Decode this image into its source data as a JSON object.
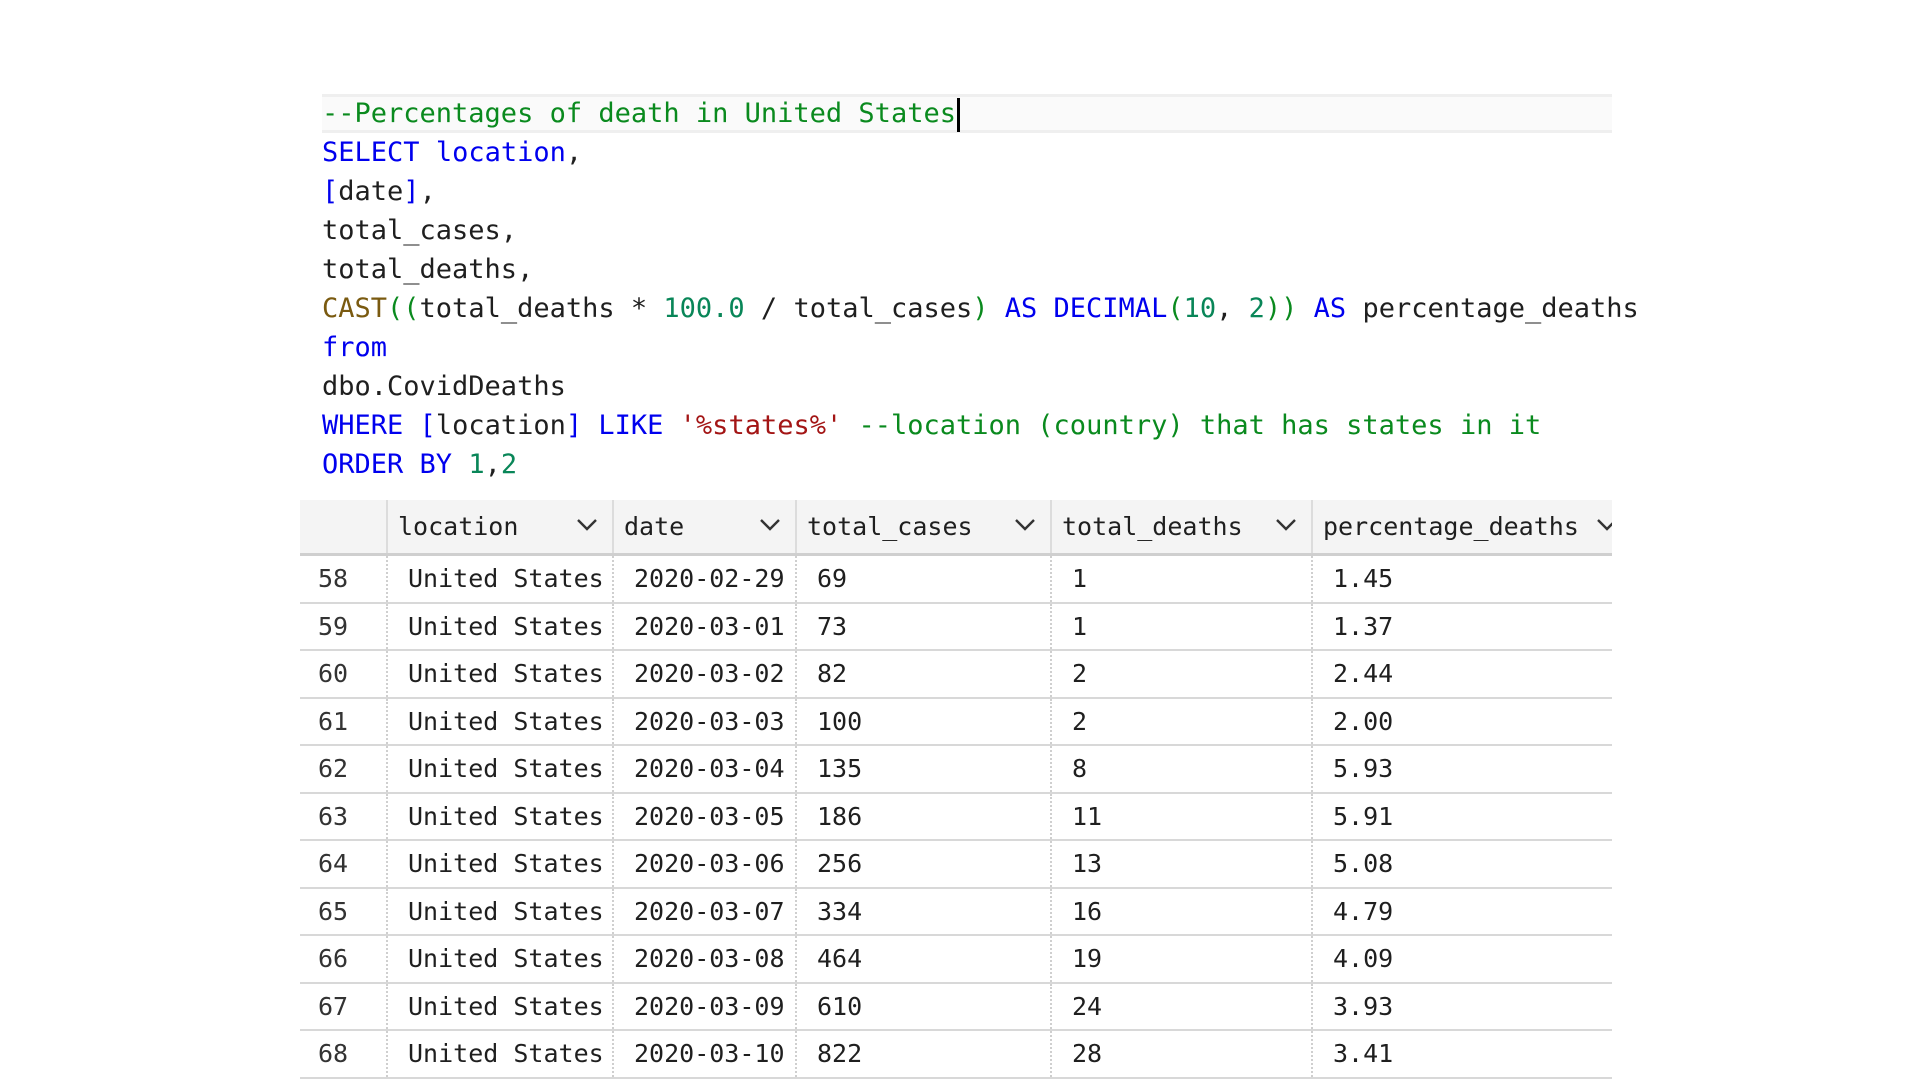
{
  "editor": {
    "lines": [
      [
        {
          "t": "--Percentages of death in United States",
          "c": "comment"
        }
      ],
      [
        {
          "t": "SELECT",
          "c": "kw"
        },
        {
          "t": " ",
          "c": "plain"
        },
        {
          "t": "location",
          "c": "kw"
        },
        {
          "t": ",",
          "c": "plain"
        }
      ],
      [
        {
          "t": "[",
          "c": "kw"
        },
        {
          "t": "date",
          "c": "plain"
        },
        {
          "t": "]",
          "c": "kw"
        },
        {
          "t": ",",
          "c": "plain"
        }
      ],
      [
        {
          "t": "total_cases,",
          "c": "plain"
        }
      ],
      [
        {
          "t": "total_deaths,",
          "c": "plain"
        }
      ],
      [
        {
          "t": "CAST",
          "c": "fn"
        },
        {
          "t": "((",
          "c": "br"
        },
        {
          "t": "total_deaths * ",
          "c": "plain"
        },
        {
          "t": "100.0",
          "c": "num"
        },
        {
          "t": " / total_cases",
          "c": "plain"
        },
        {
          "t": ")",
          "c": "br"
        },
        {
          "t": " AS DECIMAL",
          "c": "kw"
        },
        {
          "t": "(",
          "c": "br"
        },
        {
          "t": "10",
          "c": "num"
        },
        {
          "t": ", ",
          "c": "plain"
        },
        {
          "t": "2",
          "c": "num"
        },
        {
          "t": "))",
          "c": "br"
        },
        {
          "t": " AS",
          "c": "kw"
        },
        {
          "t": " percentage_deaths",
          "c": "plain"
        }
      ],
      [
        {
          "t": "from",
          "c": "kw"
        }
      ],
      [
        {
          "t": "dbo.CovidDeaths",
          "c": "plain"
        }
      ],
      [
        {
          "t": "WHERE",
          "c": "kw"
        },
        {
          "t": " ",
          "c": "plain"
        },
        {
          "t": "[",
          "c": "kw"
        },
        {
          "t": "location",
          "c": "plain"
        },
        {
          "t": "]",
          "c": "kw"
        },
        {
          "t": " LIKE ",
          "c": "kw"
        },
        {
          "t": "'%states%'",
          "c": "str"
        },
        {
          "t": " --location (country) that has states in it",
          "c": "comment"
        }
      ],
      [
        {
          "t": "ORDER BY ",
          "c": "kw"
        },
        {
          "t": "1",
          "c": "num"
        },
        {
          "t": ",",
          "c": "plain"
        },
        {
          "t": "2",
          "c": "num"
        }
      ]
    ]
  },
  "grid": {
    "columns": [
      "location",
      "date",
      "total_cases",
      "total_deaths",
      "percentage_deaths"
    ],
    "rows": [
      [
        "58",
        "United States",
        "2020-02-29",
        "69",
        "1",
        "1.45"
      ],
      [
        "59",
        "United States",
        "2020-03-01",
        "73",
        "1",
        "1.37"
      ],
      [
        "60",
        "United States",
        "2020-03-02",
        "82",
        "2",
        "2.44"
      ],
      [
        "61",
        "United States",
        "2020-03-03",
        "100",
        "2",
        "2.00"
      ],
      [
        "62",
        "United States",
        "2020-03-04",
        "135",
        "8",
        "5.93"
      ],
      [
        "63",
        "United States",
        "2020-03-05",
        "186",
        "11",
        "5.91"
      ],
      [
        "64",
        "United States",
        "2020-03-06",
        "256",
        "13",
        "5.08"
      ],
      [
        "65",
        "United States",
        "2020-03-07",
        "334",
        "16",
        "4.79"
      ],
      [
        "66",
        "United States",
        "2020-03-08",
        "464",
        "19",
        "4.09"
      ],
      [
        "67",
        "United States",
        "2020-03-09",
        "610",
        "24",
        "3.93"
      ],
      [
        "68",
        "United States",
        "2020-03-10",
        "822",
        "28",
        "3.41"
      ]
    ]
  },
  "icons": {
    "column_menu": "chevron-down-icon"
  },
  "colors": {
    "keyword": "#0000ee",
    "comment": "#0a8a1e",
    "number": "#098658",
    "string": "#a31515",
    "function": "#7a5a10"
  }
}
